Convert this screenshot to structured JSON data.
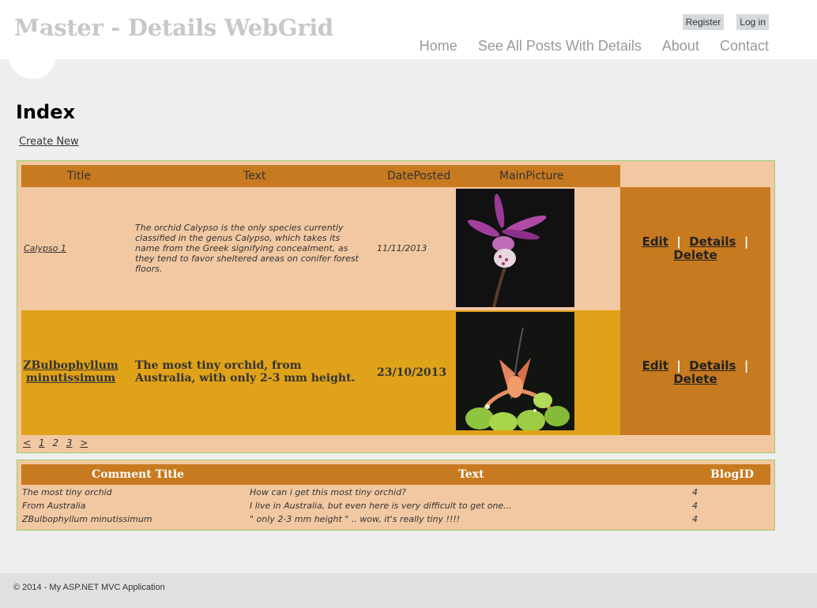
{
  "header": {
    "title": "Master - Details WebGrid",
    "login": {
      "register": "Register",
      "log_in": "Log in"
    },
    "menu": {
      "home": "Home",
      "see_all": "See All Posts With Details",
      "about": "About",
      "contact": "Contact"
    }
  },
  "page": {
    "title": "Index",
    "create_new": "Create New"
  },
  "grid": {
    "columns": {
      "title": "Title",
      "text": "Text",
      "date": "DatePosted",
      "picture": "MainPicture"
    },
    "rows": [
      {
        "title": "Calypso 1",
        "text": "The orchid Calypso is the only species currently classified in the genus Calypso, which takes its name from the Greek signifying concealment, as they tend to favor sheltered areas on conifer forest floors.",
        "date": "11/11/2013",
        "edit": "Edit",
        "details": "Details",
        "delete": "Delete",
        "sep": "|"
      },
      {
        "title": "ZBulbophyllum minutissimum",
        "text": "The most tiny orchid, from Australia, with only 2-3 mm height.",
        "date": "23/10/2013",
        "edit": "Edit",
        "details": "Details",
        "delete": "Delete",
        "sep": "|"
      }
    ],
    "pager": {
      "prev": "<",
      "p1": "1",
      "p2": "2",
      "p3": "3",
      "next": ">"
    }
  },
  "comments": {
    "columns": {
      "title": "Comment Title",
      "text": "Text",
      "blog": "BlogID"
    },
    "rows": [
      {
        "title": "The most tiny orchid",
        "text": "How can i get this most tiny orchid?",
        "blog": "4"
      },
      {
        "title": "From Australia",
        "text": "I live in Australia, but even here is very difficult to get one...",
        "blog": "4"
      },
      {
        "title": "ZBulbophyllum minutissimum",
        "text": "\" only 2-3 mm height \" .. wow, it's really tiny !!!!",
        "blog": "4"
      }
    ]
  },
  "footer": {
    "text": "© 2014 - My ASP.NET MVC Application"
  },
  "colors": {
    "accent": "#c77a1f",
    "row_light": "#f2c8a2",
    "row_dark": "#dfa219",
    "border": "#9acd6b"
  }
}
